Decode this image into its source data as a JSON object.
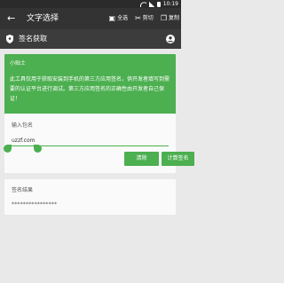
{
  "status_bar": {
    "time": "10:19"
  },
  "action_bar": {
    "back_icon": "back-arrow-icon",
    "title": "文字选择",
    "actions": [
      {
        "icon": "select-all-icon",
        "label": "全选"
      },
      {
        "icon": "cut-icon",
        "label": "剪切"
      },
      {
        "icon": "copy-icon",
        "label": "复制"
      }
    ]
  },
  "sub_bar": {
    "title": "签名获取",
    "left_icon": "shield-icon",
    "right_icon": "account-icon"
  },
  "tip": {
    "title": "小贴士",
    "body": "此工具仅用于获取安装到手机的第三方应用签名，供开发者填写到需要的认证平台进行调试。第三方应用签名的正确性由开发者自己保证！"
  },
  "input_section": {
    "label": "输入包名",
    "value": "uzzf.com"
  },
  "buttons": {
    "clear": "清除",
    "compute": "计算签名"
  },
  "result": {
    "label": "签名结果",
    "value": "****************"
  },
  "colors": {
    "accent": "#4caf50",
    "action_bar": "#333333",
    "sub_bar": "#3c3c3c",
    "background": "#e9e9e9"
  }
}
